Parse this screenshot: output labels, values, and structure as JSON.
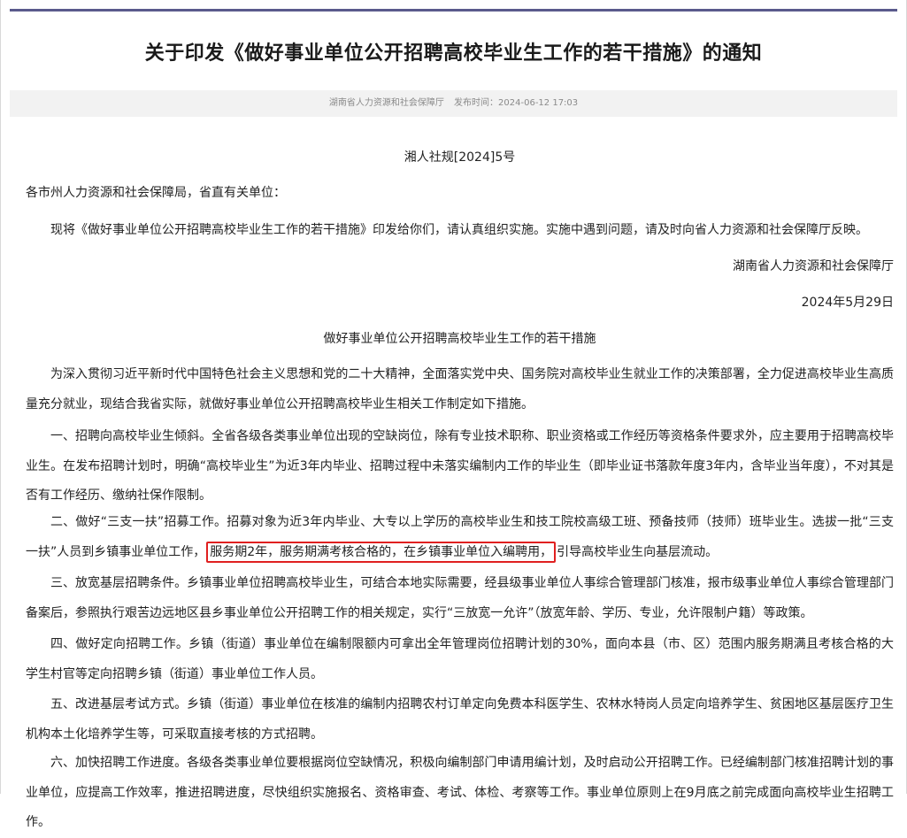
{
  "title": "关于印发《做好事业单位公开招聘高校毕业生工作的若干措施》的通知",
  "meta": {
    "publisher": "湖南省人力资源和社会保障厅",
    "date_label": "发布时间：",
    "date": "2024-06-12 17:03"
  },
  "doc_number": "湘人社规[2024]5号",
  "addressee": "各市州人力资源和社会保障局，省直有关单位：",
  "intro": "现将《做好事业单位公开招聘高校毕业生工作的若干措施》印发给你们，请认真组织实施。实施中遇到问题，请及时向省人力资源和社会保障厅反映。",
  "signature": "湖南省人力资源和社会保障厅",
  "sign_date": "2024年5月29日",
  "subtitle": "做好事业单位公开招聘高校毕业生工作的若干措施",
  "preamble": "为深入贯彻习近平新时代中国特色社会主义思想和党的二十大精神，全面落实党中央、国务院对高校毕业生就业工作的决策部署，全力促进高校毕业生高质量充分就业，现结合我省实际，就做好事业单位公开招聘高校毕业生相关工作制定如下措施。",
  "item1": "一、招聘向高校毕业生倾斜。全省各级各类事业单位出现的空缺岗位，除有专业技术职称、职业资格或工作经历等资格条件要求外，应主要用于招聘高校毕业生。在发布招聘计划时，明确“高校毕业生”为近3年内毕业、招聘过程中未落实编制内工作的毕业生（即毕业证书落款年度3年内，含毕业当年度），不对其是否有工作经历、缴纳社保作限制。",
  "item2": {
    "before": "二、做好“三支一扶”招募工作。招募对象为近3年内毕业、大专以上学历的高校毕业生和技工院校高级工班、预备技师（技师）班毕业生。选拔一批“三支一扶”人员到乡镇事业单位工作，",
    "highlight": "服务期2年，服务期满考核合格的，在乡镇事业单位入编聘用，",
    "after": "引导高校毕业生向基层流动。"
  },
  "item3": "三、放宽基层招聘条件。乡镇事业单位招聘高校毕业生，可结合本地实际需要，经县级事业单位人事综合管理部门核准，报市级事业单位人事综合管理部门备案后，参照执行艰苦边远地区县乡事业单位公开招聘工作的相关规定，实行“三放宽一允许”（放宽年龄、学历、专业，允许限制户籍）等政策。",
  "item4": "四、做好定向招聘工作。乡镇（街道）事业单位在编制限额内可拿出全年管理岗位招聘计划的30%，面向本县（市、区）范围内服务期满且考核合格的大学生村官等定向招聘乡镇（街道）事业单位工作人员。",
  "item5": "五、改进基层考试方式。乡镇（街道）事业单位在核准的编制内招聘农村订单定向免费本科医学生、农林水特岗人员定向培养学生、贫困地区基层医疗卫生机构本土化培养学生等，可采取直接考核的方式招聘。",
  "item6": "六、加快招聘工作进度。各级各类事业单位要根据岗位空缺情况，积极向编制部门申请用编计划，及时启动公开招聘工作。已经编制部门核准招聘计划的事业单位，应提高工作效率，推进招聘进度，尽快组织实施报名、资格审查、考试、体检、考察等工作。事业单位原则上在9月底之前完成面向高校毕业生招聘工作。"
}
